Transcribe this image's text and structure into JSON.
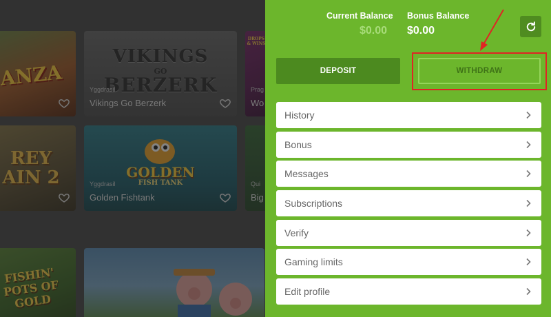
{
  "lobby": {
    "tiles": [
      {
        "art": "ANZA"
      },
      {
        "art_line1": "VIKINGS",
        "art_line2": "GO",
        "art_line3": "BERZERK",
        "provider": "Yggdrasil",
        "name": "Vikings Go Berzerk"
      },
      {
        "art": "DROPS & WINS",
        "provider": "Prag",
        "name": "Wo"
      },
      {
        "art": "REY AIN 2"
      },
      {
        "art_line1": "GOLDEN",
        "art_line2": "FISH TANK",
        "provider": "Yggdrasil",
        "name": "Golden Fishtank"
      },
      {
        "provider": "Qui",
        "name": "Big"
      },
      {
        "art": "FISHIN' POTS OF GOLD"
      },
      {
        "art": ""
      }
    ]
  },
  "account": {
    "current_balance_label": "Current Balance",
    "current_balance_value": "$0.00",
    "bonus_balance_label": "Bonus Balance",
    "bonus_balance_value": "$0.00",
    "deposit_label": "DEPOSIT",
    "withdraw_label": "WITHDRAW",
    "menu": [
      {
        "label": "History"
      },
      {
        "label": "Bonus"
      },
      {
        "label": "Messages"
      },
      {
        "label": "Subscriptions"
      },
      {
        "label": "Verify"
      },
      {
        "label": "Gaming limits"
      },
      {
        "label": "Edit profile"
      }
    ]
  },
  "colors": {
    "panel_green": "#6cb62c",
    "deposit_green": "#4c8a1f",
    "highlight_red": "#e02424"
  },
  "icons": [
    "refresh-icon",
    "heart-icon",
    "chevron-right-icon"
  ]
}
